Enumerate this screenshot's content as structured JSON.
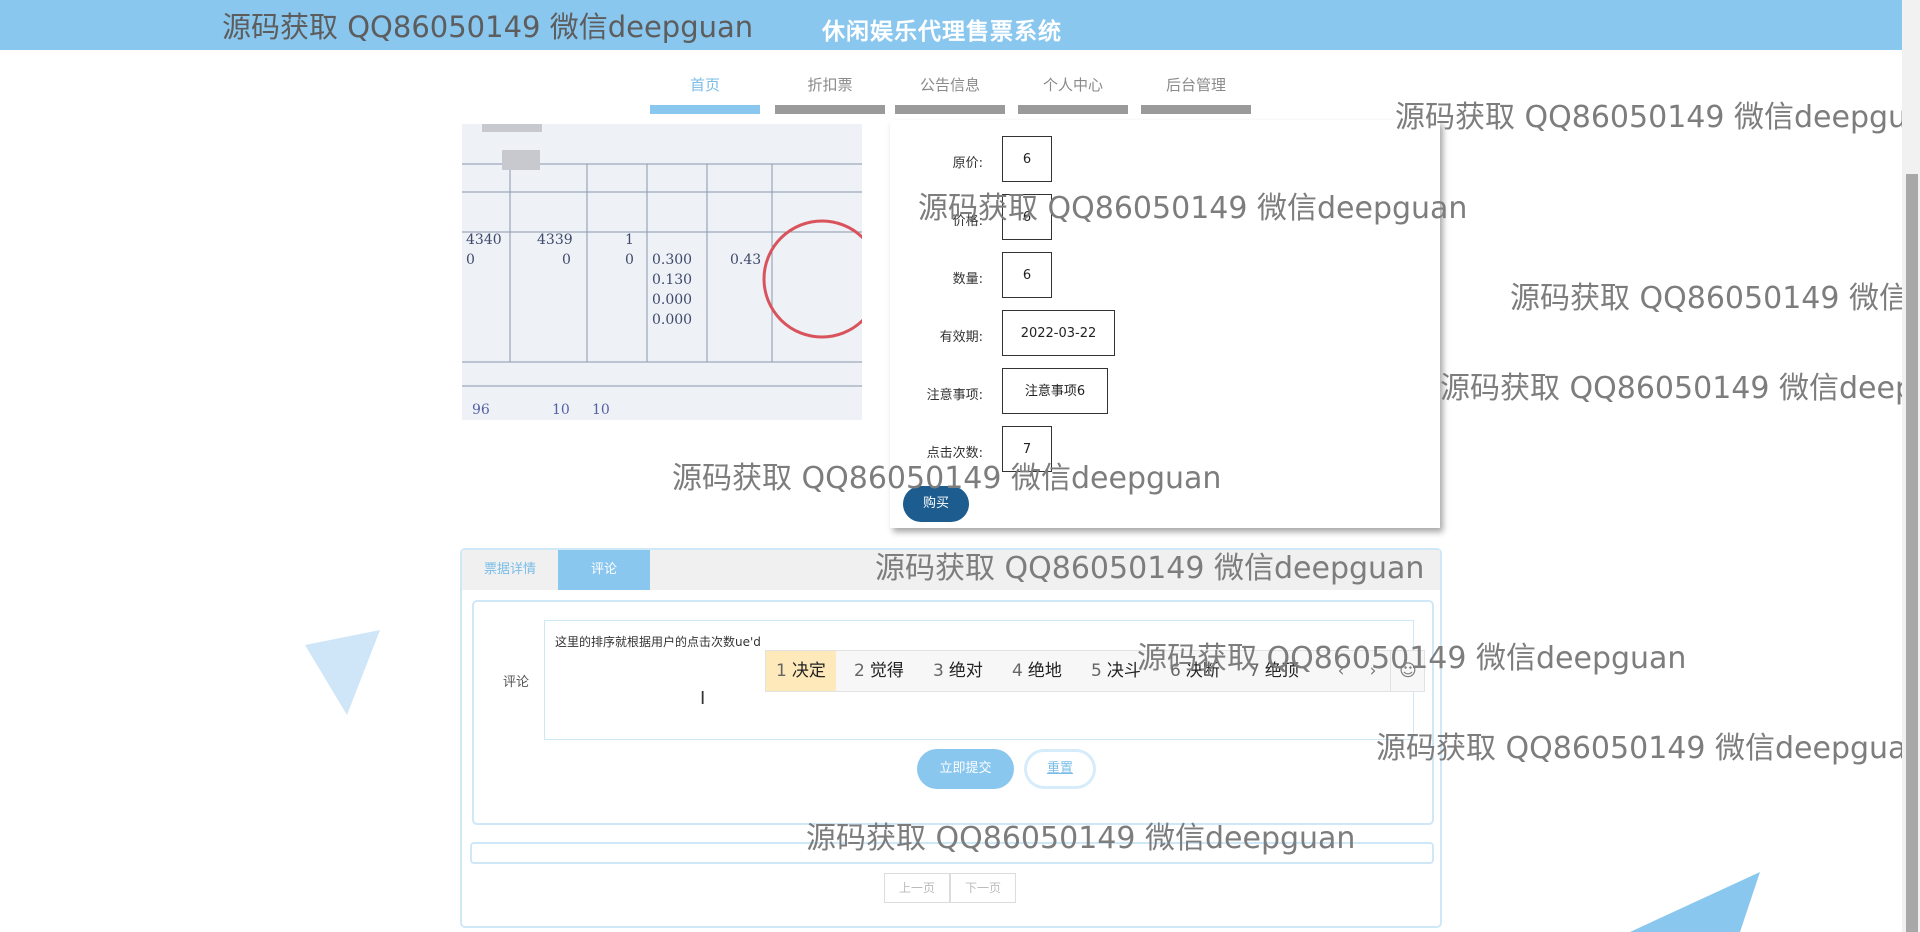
{
  "header": {
    "watermark": "源码获取 QQ86050149 微信deepguan",
    "site_title": "休闲娱乐代理售票系统"
  },
  "nav": {
    "items": [
      {
        "label": "首页",
        "active": true
      },
      {
        "label": "折扣票",
        "active": false
      },
      {
        "label": "公告信息",
        "active": false
      },
      {
        "label": "个人中心",
        "active": false
      },
      {
        "label": "后台管理",
        "active": false
      }
    ]
  },
  "ticket": {
    "original_price": {
      "label": "原价:",
      "value": "6"
    },
    "price": {
      "label": "价格:",
      "value": "6"
    },
    "quantity": {
      "label": "数量:",
      "value": "6"
    },
    "valid_until": {
      "label": "有效期:",
      "value": "2022-03-22"
    },
    "notice": {
      "label": "注意事项:",
      "value": "注意事项6"
    },
    "clicks": {
      "label": "点击次数:",
      "value": "7"
    },
    "buy_label": "购买"
  },
  "tabs": {
    "detail": "票据详情",
    "comment": "评论"
  },
  "comment_form": {
    "label": "评论",
    "text": "这里的排序就根据用户的点击次数ue'd",
    "submit_label": "立即提交",
    "reset_label": "重置"
  },
  "ime": {
    "candidates": [
      {
        "num": "1",
        "word": "决定"
      },
      {
        "num": "2",
        "word": "觉得"
      },
      {
        "num": "3",
        "word": "绝对"
      },
      {
        "num": "4",
        "word": "绝地"
      },
      {
        "num": "5",
        "word": "决斗"
      },
      {
        "num": "6",
        "word": "决断"
      },
      {
        "num": "7",
        "word": "绝顶"
      }
    ],
    "prev_label": "‹",
    "next_label": "›",
    "emoji_label": "☺"
  },
  "pager": {
    "prev_label": "上一页",
    "next_label": "下一页"
  },
  "watermark_text": "源码获取 QQ86050149 微信deepguan"
}
